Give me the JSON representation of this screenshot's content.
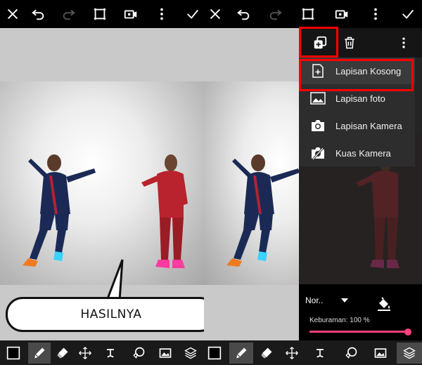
{
  "layer_menu": {
    "items": [
      {
        "label": "Lapisan Kosong",
        "icon": "blank-layer-icon"
      },
      {
        "label": "Lapisan foto",
        "icon": "photo-layer-icon"
      },
      {
        "label": "Lapisan Kamera",
        "icon": "camera-icon"
      },
      {
        "label": "Kuas Kamera",
        "icon": "camera-brush-icon"
      }
    ]
  },
  "blend_mode": "Nor..",
  "opacity_label": "Keburaman: 100 %",
  "opacity_value": 100,
  "callout_text": "HASILNYA",
  "colors": {
    "accent": "#ff3f7f",
    "highlight_box": "#ff0000",
    "menu_bg": "#2d2d2d",
    "toolbar_bg": "#000000"
  }
}
